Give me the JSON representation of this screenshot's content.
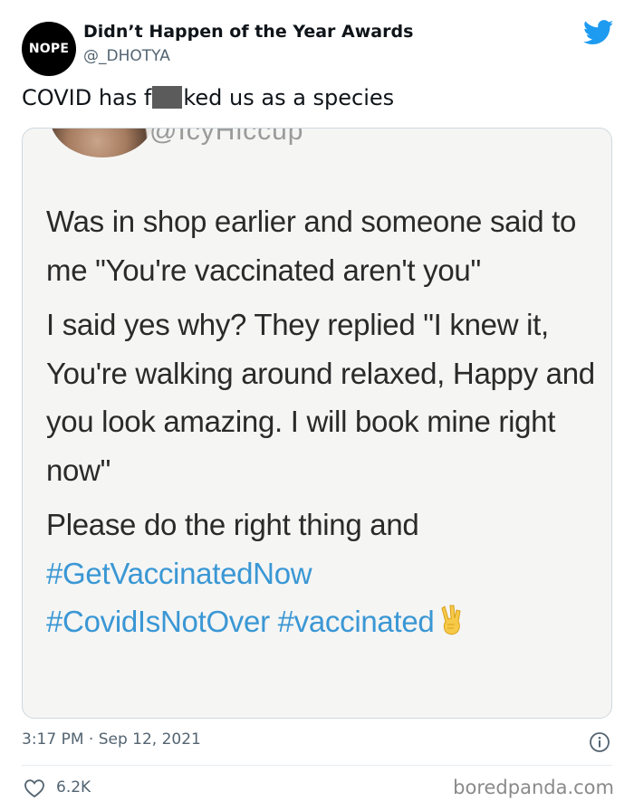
{
  "author": {
    "avatar_text": "NOPE",
    "display_name": "Didn’t Happen of the Year Awards",
    "handle": "@_DHOTYA"
  },
  "tweet": {
    "text_before": "COVID has f",
    "text_after": "ked us as a species",
    "timestamp": "3:17 PM · Sep 12, 2021",
    "likes": "6.2K"
  },
  "embed": {
    "handle_partial": "@IcyHiccup",
    "paragraphs": [
      "Was in shop earlier and someone said to me \"You're vaccinated aren't you\"",
      "I said yes why? They replied \"I knew it, You're walking around relaxed, Happy and you look amazing. I will book mine right now\"",
      "Please do the right thing and"
    ],
    "hashtags": [
      "#GetVaccinatedNow",
      "#CovidIsNotOver #vaccinated"
    ]
  },
  "watermark": "boredpanda.com",
  "colors": {
    "twitter_blue": "#1d9bf0",
    "hashtag": "#3a97d4",
    "secondary_text": "#536471"
  },
  "icons": [
    "twitter-bird-icon",
    "info-icon",
    "heart-icon",
    "peace-hand-emoji-icon"
  ]
}
